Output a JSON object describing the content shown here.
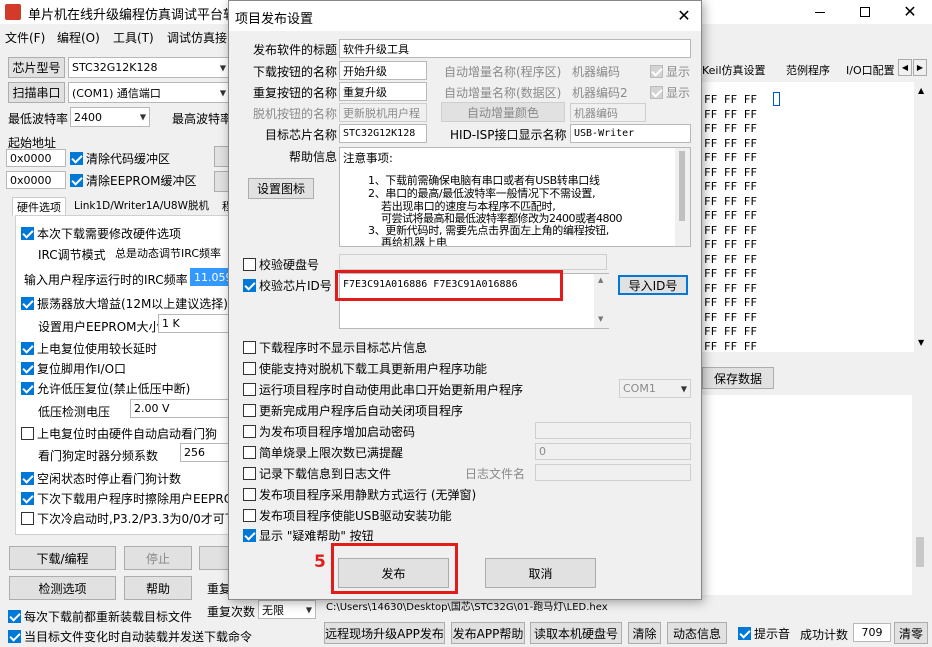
{
  "app": {
    "title": "单片机在线升级编程仿真调试平台软件",
    "menu": [
      "文件(F)",
      "编程(O)",
      "工具(T)",
      "调试仿真接"
    ],
    "chip_label": "芯片型号",
    "chip_value": "STC32G12K128",
    "scan_port_label": "扫描串口",
    "port_value": "(COM1) 通信端口",
    "min_baud_label": "最低波特率",
    "min_baud_value": "2400",
    "max_baud_label": "最高波特率",
    "start_addr_label": "起始地址",
    "addr1": "0x0000",
    "addr2": "0x0000",
    "clear_code_label": "清除代码缓冲区",
    "clear_eeprom_label": "清除EEPROM缓冲区",
    "tabs": [
      "硬件选项",
      "Link1D/Writer1A/U8W脱机",
      "程"
    ],
    "opt1": "本次下载需要修改硬件选项",
    "irc_mode_label": "IRC调节模式",
    "irc_mode_value": "总是动态调节IRC频率",
    "irc_freq_label": "输入用户程序运行时的IRC频率",
    "irc_freq_value": "11.0592",
    "osc_label": "振荡器放大增益(12M以上建议选择)",
    "eeprom_size_label": "设置用户EEPROM大小",
    "eeprom_size_value": "1   K",
    "opt_poweron": "上电复位使用较长延时",
    "opt_resetpin": "复位脚用作I/O口",
    "opt_lvr": "允许低压复位(禁止低压中断)",
    "lvr_label": "低压检测电压",
    "lvr_value": "2.00 V",
    "opt_wdt": "上电复位时由硬件自动启动看门狗",
    "wdt_div_label": "看门狗定时器分频系数",
    "wdt_div_value": "256",
    "opt_idle": "空闲状态时停止看门狗计数",
    "opt_erase": "下次下载用户程序时擦除用户EEPROM",
    "opt_cold": "下次冷启动时,P3.2/P3.3为0/0才可下",
    "btn_download": "下载/编程",
    "btn_stop": "停止",
    "btn_detect": "检测选项",
    "btn_help": "帮助",
    "btn_retry_label": "重复",
    "retry_count_label": "重复次数",
    "retry_count_value": "无限",
    "opt_reload": "每次下载前都重新装载目标文件",
    "opt_autosend": "当目标文件变化时自动装载并发送下载命令",
    "right_tabs": [
      "Keil仿真设置",
      "范例程序",
      "I/O口配置"
    ],
    "hex_rows": [
      "FF FF FF",
      "FF FF FF",
      "FF FF FF",
      "FF FF FF",
      "FF FF FF",
      "FF FF FF",
      "FF FF FF",
      "FF FF FF",
      "FF FF FF",
      "FF FF FF",
      "FF FF FF",
      "FF FF FF",
      "FF FF FF",
      "FF FF FF",
      "FF FF FF",
      "FF FF FF",
      "FF FF FF",
      "FF FF FF"
    ],
    "save_data": "保存数据",
    "path": "C:\\Users\\14630\\Desktop\\国芯\\STC32G\\01-跑马灯\\LED.hex",
    "bottom_btns": [
      "远程现场升级APP发布",
      "发布APP帮助",
      "读取本机硬盘号",
      "清除",
      "动态信息"
    ],
    "beep_label": "提示音",
    "success_label": "成功计数",
    "success_count": "709",
    "clear_btn": "清零"
  },
  "dialog": {
    "title": "项目发布设置",
    "rows": {
      "release_title_label": "发布软件的标题",
      "release_title_value": "软件升级工具",
      "download_btn_label": "下载按钮的名称",
      "download_btn_value": "开始升级",
      "retry_btn_label": "重复按钮的名称",
      "retry_btn_value": "重复升级",
      "offline_btn_label": "脱机按钮的名称",
      "offline_btn_value": "更新脱机用户程",
      "target_chip_label": "目标芯片名称",
      "target_chip_value": "STC32G12K128",
      "auto_inc_prog": "自动增量名称(程序区)",
      "machine_code": "机器编码",
      "show1": "显示",
      "auto_inc_data": "自动增量名称(数据区)",
      "machine_code2": "机器编码2",
      "show2": "显示",
      "auto_inc_color": "自动增量颜色",
      "machine_code_input": "机器编码",
      "hid_label": "HID-ISP接口显示名称",
      "hid_value": "USB-Writer"
    },
    "help_info_label": "帮助信息",
    "set_icon_btn": "设置图标",
    "help_lines": [
      "注意事项:",
      "1、下载前需确保电脑有串口或者有USB转串口线",
      "2、串口的最高/最低波特率一般情况下不需设置,",
      "若出现串口的速度与本程序不匹配时,",
      "可尝试将最高和最低波特率都修改为2400或者4800",
      "3、更新代码时, 需要先点击界面左上角的编程按钮,",
      "再给机器上电"
    ],
    "verify_disk_label": "校验硬盘号",
    "verify_chip_label": "校验芯片ID号",
    "chip_ids": "F7E3C91A016886 F7E3C91A016886",
    "import_id_btn": "导入ID号",
    "options": [
      "下载程序时不显示目标芯片信息",
      "使能支持对脱机下载工具更新用户程序功能",
      "运行项目程序时自动使用此串口开始更新用户程序",
      "更新完成用户程序后自动关闭项目程序",
      "为发布项目程序增加启动密码",
      "简单烧录上限次数已满提醒",
      "记录下载信息到日志文件",
      "发布项目程序采用静默方式运行 (无弹窗)",
      "发布项目程序使能USB驱动安装功能",
      "显示 \"疑难帮助\" 按钮"
    ],
    "com_value": "COM1",
    "limit_value": "0",
    "log_file_label": "日志文件名",
    "publish_btn": "发布",
    "cancel_btn": "取消",
    "step_number": "5",
    "highlight_color": "#e21b1b"
  }
}
